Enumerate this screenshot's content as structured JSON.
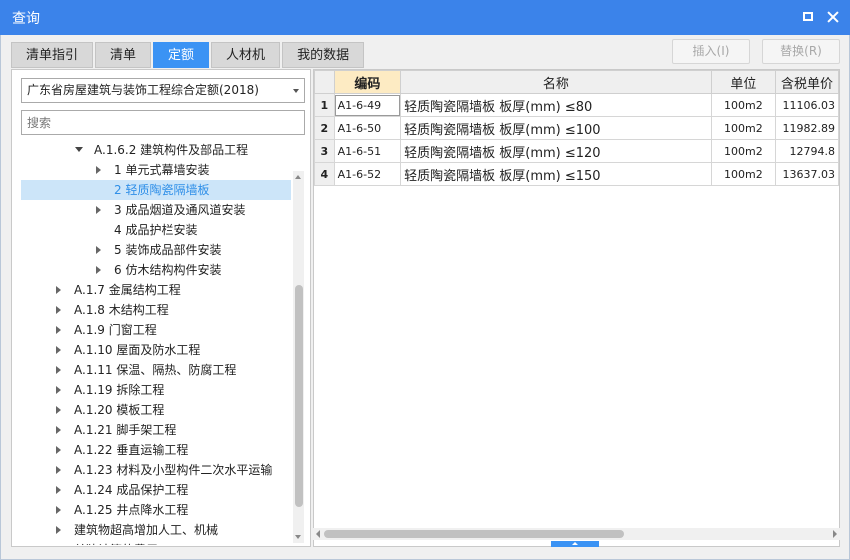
{
  "window": {
    "title": "查询"
  },
  "tabs": [
    {
      "label": "清单指引",
      "active": false
    },
    {
      "label": "清单",
      "active": false
    },
    {
      "label": "定额",
      "active": true
    },
    {
      "label": "人材机",
      "active": false
    },
    {
      "label": "我的数据",
      "active": false
    }
  ],
  "actions": {
    "insert_label": "插入(I)",
    "replace_label": "替换(R)"
  },
  "left": {
    "library": "广东省房屋建筑与装饰工程综合定额(2018)",
    "search_placeholder": "搜索"
  },
  "tree": [
    {
      "label": "A.1.6.2 建筑构件及部品工程",
      "indent": 1,
      "toggle": "open",
      "selected": false
    },
    {
      "label": "1 单元式幕墙安装",
      "indent": 2,
      "toggle": "closed",
      "selected": false
    },
    {
      "label": "2 轻质陶瓷隔墙板",
      "indent": 2,
      "toggle": "none",
      "selected": true
    },
    {
      "label": "3 成品烟道及通风道安装",
      "indent": 2,
      "toggle": "closed",
      "selected": false
    },
    {
      "label": "4 成品护栏安装",
      "indent": 2,
      "toggle": "none",
      "selected": false
    },
    {
      "label": "5 装饰成品部件安装",
      "indent": 2,
      "toggle": "closed",
      "selected": false
    },
    {
      "label": "6 仿木结构构件安装",
      "indent": 2,
      "toggle": "closed",
      "selected": false
    },
    {
      "label": "A.1.7 金属结构工程",
      "indent": 0,
      "toggle": "closed",
      "selected": false
    },
    {
      "label": "A.1.8 木结构工程",
      "indent": 0,
      "toggle": "closed",
      "selected": false
    },
    {
      "label": "A.1.9 门窗工程",
      "indent": 0,
      "toggle": "closed",
      "selected": false
    },
    {
      "label": "A.1.10 屋面及防水工程",
      "indent": 0,
      "toggle": "closed",
      "selected": false
    },
    {
      "label": "A.1.11 保温、隔热、防腐工程",
      "indent": 0,
      "toggle": "closed",
      "selected": false
    },
    {
      "label": "A.1.19 拆除工程",
      "indent": 0,
      "toggle": "closed",
      "selected": false
    },
    {
      "label": "A.1.20 模板工程",
      "indent": 0,
      "toggle": "closed",
      "selected": false
    },
    {
      "label": "A.1.21 脚手架工程",
      "indent": 0,
      "toggle": "closed",
      "selected": false
    },
    {
      "label": "A.1.22 垂直运输工程",
      "indent": 0,
      "toggle": "closed",
      "selected": false
    },
    {
      "label": "A.1.23 材料及小型构件二次水平运输",
      "indent": 0,
      "toggle": "closed",
      "selected": false
    },
    {
      "label": "A.1.24 成品保护工程",
      "indent": 0,
      "toggle": "closed",
      "selected": false
    },
    {
      "label": "A.1.25 井点降水工程",
      "indent": 0,
      "toggle": "closed",
      "selected": false
    },
    {
      "label": "建筑物超高增加人工、机械",
      "indent": 0,
      "toggle": "closed",
      "selected": false
    },
    {
      "label": "单独计算的费用",
      "indent": 0,
      "toggle": "closed",
      "selected": false
    }
  ],
  "table": {
    "headers": {
      "code": "编码",
      "name": "名称",
      "unit": "单位",
      "price": "含税单价"
    },
    "rows": [
      {
        "no": "1",
        "code": "A1-6-49",
        "name": "轻质陶瓷隔墙板 板厚(mm) ≤80",
        "unit": "100m2",
        "price": "11106.03"
      },
      {
        "no": "2",
        "code": "A1-6-50",
        "name": "轻质陶瓷隔墙板 板厚(mm) ≤100",
        "unit": "100m2",
        "price": "11982.89"
      },
      {
        "no": "3",
        "code": "A1-6-51",
        "name": "轻质陶瓷隔墙板 板厚(mm) ≤120",
        "unit": "100m2",
        "price": "12794.8"
      },
      {
        "no": "4",
        "code": "A1-6-52",
        "name": "轻质陶瓷隔墙板 板厚(mm) ≤150",
        "unit": "100m2",
        "price": "13637.03"
      }
    ]
  }
}
